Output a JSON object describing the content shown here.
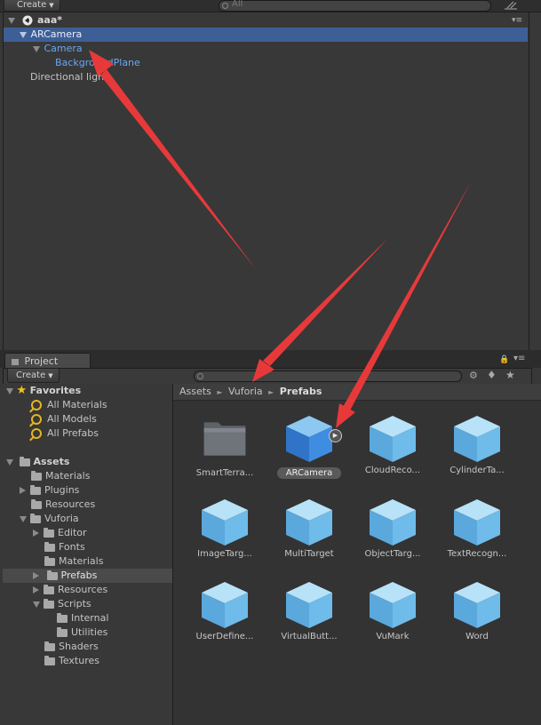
{
  "hierarchy": {
    "create_label": "Create",
    "search_placeholder": "All",
    "scene_name": "aaa*",
    "items": [
      {
        "label": "ARCamera"
      },
      {
        "label": "Camera"
      },
      {
        "label": "BackgroundPlane"
      },
      {
        "label": "Directional light"
      }
    ]
  },
  "project": {
    "tab_label": "Project",
    "create_label": "Create",
    "breadcrumb": [
      "Assets",
      "Vuforia",
      "Prefabs"
    ],
    "favorites": {
      "label": "Favorites",
      "items": [
        "All Materials",
        "All Models",
        "All Prefabs"
      ]
    },
    "tree": {
      "assets_label": "Assets",
      "items": [
        "Materials",
        "Plugins",
        "Resources",
        "Vuforia",
        "Editor",
        "Fonts",
        "Materials",
        "Prefabs",
        "Resources",
        "Scripts",
        "Internal",
        "Utilities",
        "Shaders",
        "Textures"
      ]
    },
    "assets": [
      {
        "label": "SmartTerra..."
      },
      {
        "label": "ARCamera"
      },
      {
        "label": "CloudReco..."
      },
      {
        "label": "CylinderTa..."
      },
      {
        "label": "ImageTarg..."
      },
      {
        "label": "MultiTarget"
      },
      {
        "label": "ObjectTarg..."
      },
      {
        "label": "TextRecogn..."
      },
      {
        "label": "UserDefine..."
      },
      {
        "label": "VirtualButt..."
      },
      {
        "label": "VuMark"
      },
      {
        "label": "Word"
      }
    ]
  },
  "colors": {
    "selection": "#3e5f96",
    "child_text": "#6aa6f3",
    "arrow": "#e8393a"
  }
}
